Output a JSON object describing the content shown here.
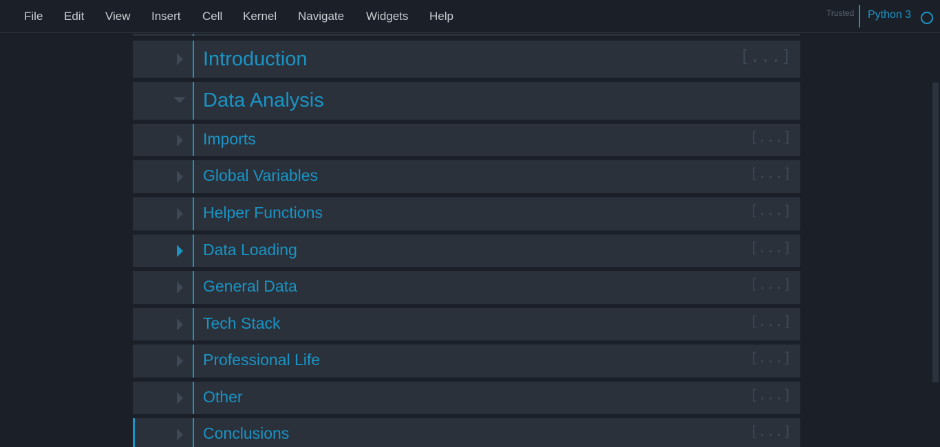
{
  "menubar": {
    "items": [
      "File",
      "Edit",
      "View",
      "Insert",
      "Cell",
      "Kernel",
      "Navigate",
      "Widgets",
      "Help"
    ],
    "trusted_label": "Trusted",
    "kernel_name": "Python 3"
  },
  "cells": [
    {
      "heading": "Introduction",
      "level": 1,
      "collapsed": true,
      "ellipsis": "[...]"
    },
    {
      "heading": "Data Analysis",
      "level": 1,
      "collapsed": false,
      "ellipsis": ""
    },
    {
      "heading": "Imports",
      "level": 2,
      "collapsed": true,
      "ellipsis": "[...]"
    },
    {
      "heading": "Global Variables",
      "level": 2,
      "collapsed": true,
      "ellipsis": "[...]"
    },
    {
      "heading": "Helper Functions",
      "level": 2,
      "collapsed": true,
      "ellipsis": "[...]"
    },
    {
      "heading": "Data Loading",
      "level": 2,
      "collapsed": true,
      "ellipsis": "[...]",
      "arrow_active": true
    },
    {
      "heading": "General Data",
      "level": 2,
      "collapsed": true,
      "ellipsis": "[...]"
    },
    {
      "heading": "Tech Stack",
      "level": 2,
      "collapsed": true,
      "ellipsis": "[...]"
    },
    {
      "heading": "Professional Life",
      "level": 2,
      "collapsed": true,
      "ellipsis": "[...]"
    },
    {
      "heading": "Other",
      "level": 2,
      "collapsed": true,
      "ellipsis": "[...]"
    },
    {
      "heading": "Conclusions",
      "level": 2,
      "collapsed": true,
      "ellipsis": "[...]",
      "selected": true
    }
  ],
  "colors": {
    "accent": "#1a94c4",
    "cell_background": "#2a313b",
    "page_background": "#1b2028"
  },
  "icons": {
    "collapsed": "caret-right-icon",
    "expanded": "caret-down-icon",
    "kernel_status": "kernel-idle-circle-icon"
  }
}
